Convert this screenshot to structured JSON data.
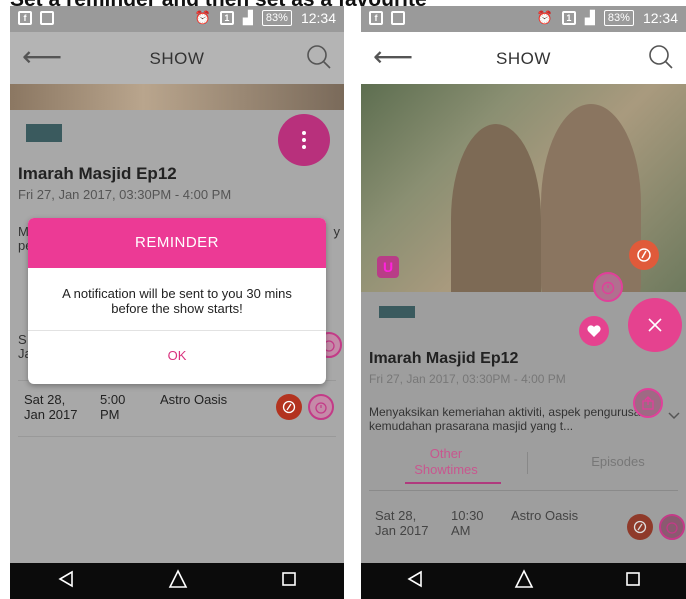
{
  "caption": "Set a reminder and then set as a favourite",
  "left": {
    "status": {
      "battery": "83%",
      "time": "12:34",
      "sim": "1"
    },
    "appbar": {
      "title": "SHOW"
    },
    "episode": {
      "title": "Imarah Masjid Ep12",
      "time": "Fri 27, Jan 2017, 03:30PM - 4:00 PM"
    },
    "partial": {
      "m": "M",
      "pe": "pe",
      "y": "y",
      "s": "S",
      "ja": "Ja"
    },
    "dialog": {
      "title": "REMINDER",
      "message": "A notification will be sent to you 30 mins before the show starts!",
      "ok_label": "OK"
    },
    "schedule": [
      {
        "date": "Sat 28, Jan 2017",
        "time": "5:00 PM",
        "channel": "Astro Oasis"
      }
    ]
  },
  "right": {
    "status": {
      "battery": "83%",
      "time": "12:34",
      "sim": "1"
    },
    "appbar": {
      "title": "SHOW"
    },
    "badge": "U",
    "episode": {
      "title": "Imarah Masjid Ep12",
      "time": "Fri 27, Jan 2017, 03:30PM - 4:00 PM"
    },
    "description": "Menyaksikan kemeriahan aktiviti, aspek pengurusan, kemudahan prasarana masjid yang t...",
    "tabs": [
      {
        "label": "Other Showtimes"
      },
      {
        "label": "Episodes"
      }
    ],
    "schedule": [
      {
        "date": "Sat 28, Jan 2017",
        "time": "10:30 AM",
        "channel": "Astro Oasis"
      }
    ]
  },
  "colors": {
    "accent": "#ec3a95",
    "record": "#b3331f",
    "fab": "#e5428f"
  }
}
